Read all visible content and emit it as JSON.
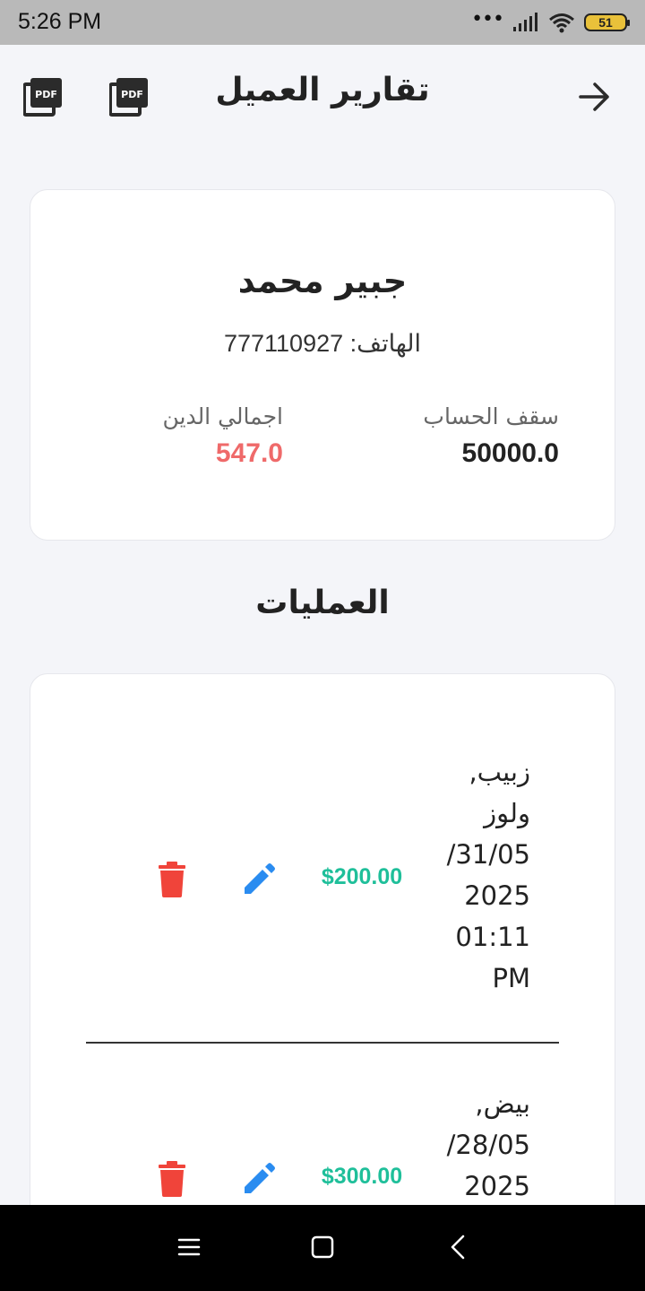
{
  "status_bar": {
    "time": "5:26  PM",
    "dots": "•••",
    "battery": "51"
  },
  "header": {
    "title": "تقارير العميل",
    "pdf_label": "PDF"
  },
  "customer": {
    "name": "جبير محمد",
    "phone_label": "الهاتف: 777110927",
    "credit_limit_label": "سقف الحساب",
    "credit_limit_value": "50000.0",
    "total_debt_label": "اجمالي الدين",
    "total_debt_value": "547.0"
  },
  "operations": {
    "title": "العمليات",
    "items": [
      {
        "line1": "زبيب,",
        "line2": "ولوز",
        "line3": "31/05/",
        "line4": "2025",
        "line5": "01:11",
        "line6": "PM",
        "amount": "$200.00"
      },
      {
        "line1": "بيض,",
        "line2": "28/05/",
        "line3": "2025",
        "amount": "$300.00"
      }
    ]
  },
  "colors": {
    "amount": "#1fbf9a",
    "debt": "#ef6a6a",
    "edit": "#2a8cf0",
    "delete": "#f0443a"
  }
}
